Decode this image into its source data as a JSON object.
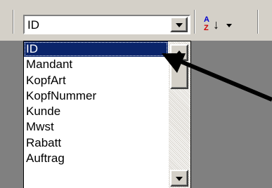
{
  "toolbar": {
    "field_combo": {
      "value": "ID"
    },
    "sort_button": {
      "icon": "sort-ascending-icon",
      "top_letter": "A",
      "bottom_letter": "Z"
    }
  },
  "dropdown": {
    "items": [
      {
        "label": "ID",
        "selected": true
      },
      {
        "label": "Mandant"
      },
      {
        "label": "KopfArt"
      },
      {
        "label": "KopfNummer"
      },
      {
        "label": "Kunde"
      },
      {
        "label": "Mwst"
      },
      {
        "label": "Rabatt"
      },
      {
        "label": "Auftrag"
      }
    ]
  },
  "colors": {
    "face": "#d4d0c8",
    "selection": "#0a246a",
    "background": "#808080"
  }
}
